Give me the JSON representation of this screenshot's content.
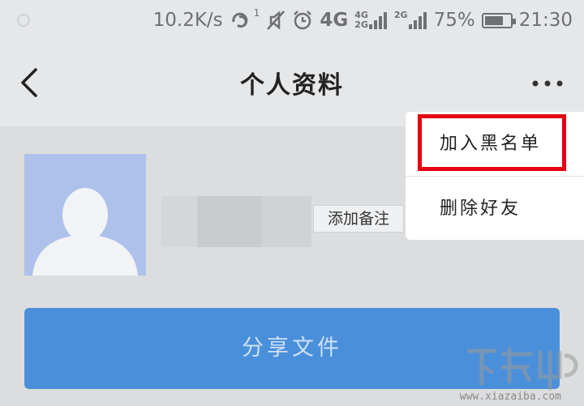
{
  "status_bar": {
    "network_speed": "10.2K/s",
    "sim_badge": "1",
    "net_type": "4G",
    "net_stack_top": "4G",
    "net_stack_bottom": "2G",
    "net_type_2": "2G",
    "battery": "75%",
    "battery_level": 0.75,
    "time": "21:30"
  },
  "nav": {
    "title": "个人资料"
  },
  "profile": {
    "add_remark_label": "添加备注",
    "share_button_label": "分享文件"
  },
  "menu": {
    "items": [
      {
        "label": "加入黑名单",
        "highlighted": true
      },
      {
        "label": "删除好友",
        "highlighted": false
      }
    ]
  },
  "watermark": {
    "text": "www.xiazaiba.com"
  },
  "colors": {
    "accent_blue": "#4a8fda",
    "highlight_red": "#e60012",
    "avatar_bg": "#adc1ea"
  }
}
